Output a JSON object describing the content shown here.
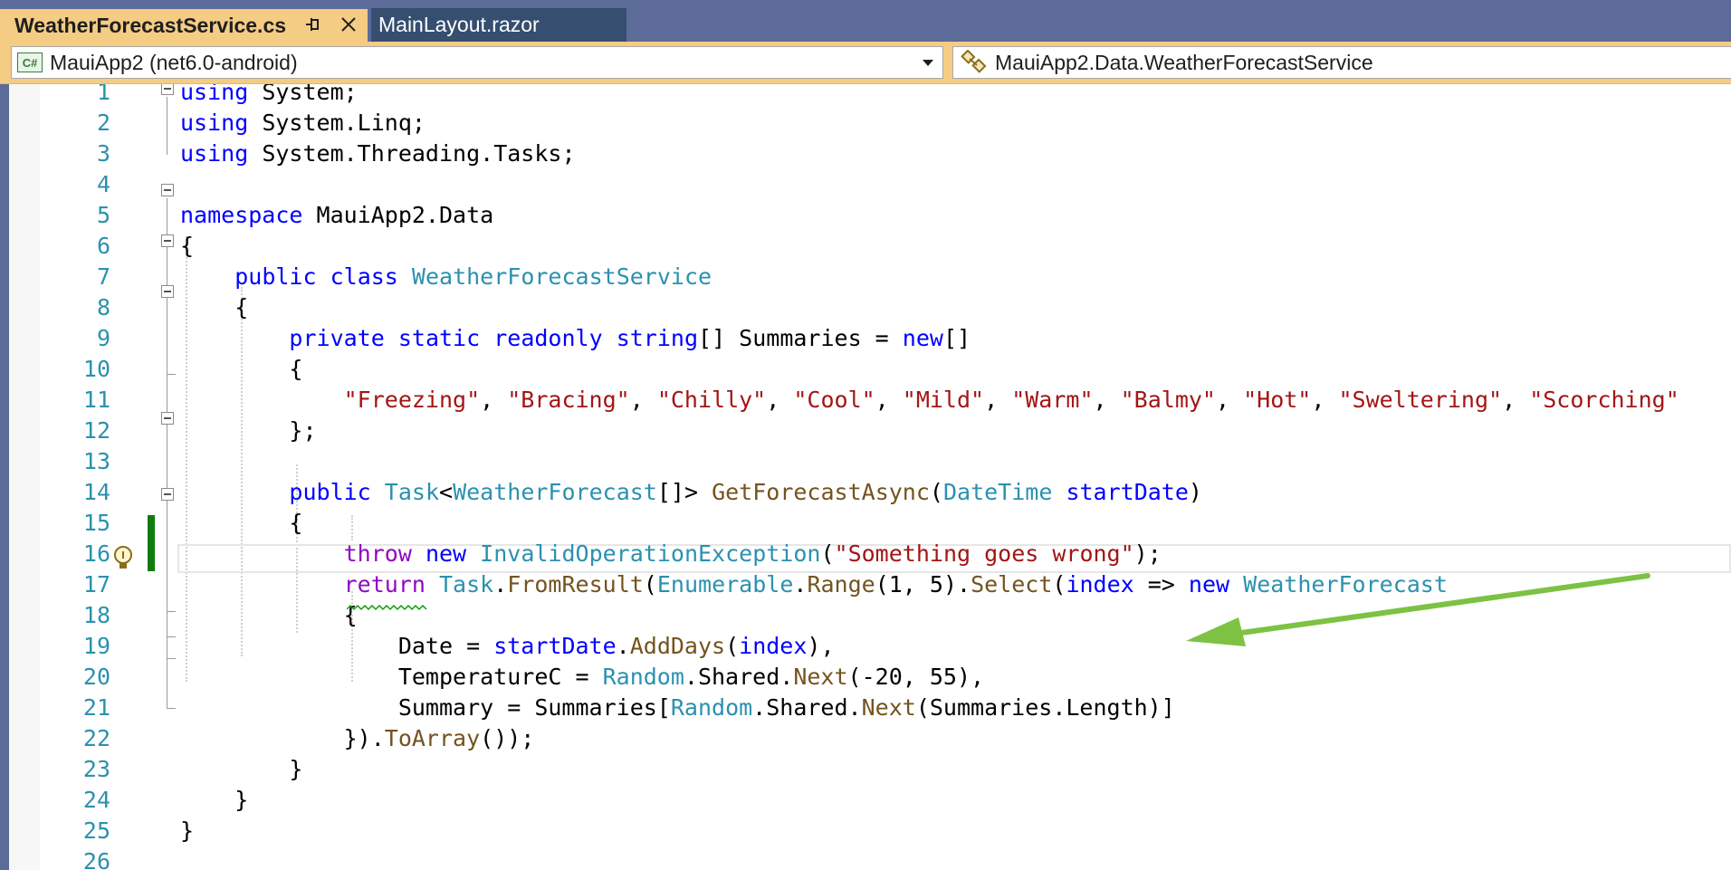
{
  "tabs": [
    {
      "label": "WeatherForecastService.cs",
      "active": true
    },
    {
      "label": "MainLayout.razor",
      "active": false
    }
  ],
  "navbar": {
    "project_icon": "C#",
    "project": "MauiApp2 (net6.0-android)",
    "type": "MauiApp2.Data.WeatherForecastService"
  },
  "colors": {
    "keyword": "#0000ff",
    "control_keyword": "#8f08c4",
    "type": "#2b91af",
    "string": "#a31515",
    "method": "#74531f",
    "line_number": "#2b91af",
    "active_tab": "#f5cc84",
    "change_bar": "#107c10",
    "annotation_arrow": "#7dc243"
  },
  "editor": {
    "highlighted_line": 16,
    "lines": [
      {
        "n": "1",
        "tokens": [
          {
            "t": "using",
            "c": "kw"
          },
          {
            "t": " System;"
          }
        ]
      },
      {
        "n": "2",
        "tokens": [
          {
            "t": "using",
            "c": "kw"
          },
          {
            "t": " System.Linq;"
          }
        ]
      },
      {
        "n": "3",
        "tokens": [
          {
            "t": "using",
            "c": "kw"
          },
          {
            "t": " System.Threading.Tasks;"
          }
        ]
      },
      {
        "n": "4",
        "tokens": []
      },
      {
        "n": "5",
        "tokens": [
          {
            "t": "namespace",
            "c": "kw"
          },
          {
            "t": " MauiApp2.Data"
          }
        ]
      },
      {
        "n": "6",
        "tokens": [
          {
            "t": "{"
          }
        ]
      },
      {
        "n": "7",
        "tokens": [
          {
            "t": "    "
          },
          {
            "t": "public",
            "c": "kw"
          },
          {
            "t": " "
          },
          {
            "t": "class",
            "c": "kw"
          },
          {
            "t": " "
          },
          {
            "t": "WeatherForecastService",
            "c": "ty"
          }
        ]
      },
      {
        "n": "8",
        "tokens": [
          {
            "t": "    {"
          }
        ]
      },
      {
        "n": "9",
        "tokens": [
          {
            "t": "        "
          },
          {
            "t": "private",
            "c": "kw"
          },
          {
            "t": " "
          },
          {
            "t": "static",
            "c": "kw"
          },
          {
            "t": " "
          },
          {
            "t": "readonly",
            "c": "kw"
          },
          {
            "t": " "
          },
          {
            "t": "string",
            "c": "kw"
          },
          {
            "t": "[] Summaries = "
          },
          {
            "t": "new",
            "c": "kw"
          },
          {
            "t": "[]"
          }
        ]
      },
      {
        "n": "10",
        "tokens": [
          {
            "t": "        {"
          }
        ]
      },
      {
        "n": "11",
        "tokens": [
          {
            "t": "            "
          },
          {
            "t": "\"Freezing\"",
            "c": "str"
          },
          {
            "t": ", "
          },
          {
            "t": "\"Bracing\"",
            "c": "str"
          },
          {
            "t": ", "
          },
          {
            "t": "\"Chilly\"",
            "c": "str"
          },
          {
            "t": ", "
          },
          {
            "t": "\"Cool\"",
            "c": "str"
          },
          {
            "t": ", "
          },
          {
            "t": "\"Mild\"",
            "c": "str"
          },
          {
            "t": ", "
          },
          {
            "t": "\"Warm\"",
            "c": "str"
          },
          {
            "t": ", "
          },
          {
            "t": "\"Balmy\"",
            "c": "str"
          },
          {
            "t": ", "
          },
          {
            "t": "\"Hot\"",
            "c": "str"
          },
          {
            "t": ", "
          },
          {
            "t": "\"Sweltering\"",
            "c": "str"
          },
          {
            "t": ", "
          },
          {
            "t": "\"Scorching\"",
            "c": "str"
          }
        ]
      },
      {
        "n": "12",
        "tokens": [
          {
            "t": "        };"
          }
        ]
      },
      {
        "n": "13",
        "tokens": []
      },
      {
        "n": "14",
        "tokens": [
          {
            "t": "        "
          },
          {
            "t": "public",
            "c": "kw"
          },
          {
            "t": " "
          },
          {
            "t": "Task",
            "c": "ty"
          },
          {
            "t": "<"
          },
          {
            "t": "WeatherForecast",
            "c": "ty"
          },
          {
            "t": "[]> "
          },
          {
            "t": "GetForecastAsync",
            "c": "fn"
          },
          {
            "t": "("
          },
          {
            "t": "DateTime",
            "c": "ty"
          },
          {
            "t": " "
          },
          {
            "t": "startDate",
            "c": "kw"
          },
          {
            "t": ")"
          }
        ]
      },
      {
        "n": "15",
        "tokens": [
          {
            "t": "        {"
          }
        ]
      },
      {
        "n": "16",
        "tokens": [
          {
            "t": "            "
          },
          {
            "t": "throw",
            "c": "kw2"
          },
          {
            "t": " "
          },
          {
            "t": "new",
            "c": "kw"
          },
          {
            "t": " "
          },
          {
            "t": "InvalidOperationException",
            "c": "ty"
          },
          {
            "t": "("
          },
          {
            "t": "\"Something goes wrong\"",
            "c": "str"
          },
          {
            "t": ");"
          }
        ]
      },
      {
        "n": "17",
        "tokens": [
          {
            "t": "            "
          },
          {
            "t": "return",
            "c": "kw2"
          },
          {
            "t": " "
          },
          {
            "t": "Task",
            "c": "ty"
          },
          {
            "t": "."
          },
          {
            "t": "FromResult",
            "c": "fn"
          },
          {
            "t": "("
          },
          {
            "t": "Enumerable",
            "c": "ty"
          },
          {
            "t": "."
          },
          {
            "t": "Range",
            "c": "fn"
          },
          {
            "t": "(1, 5)."
          },
          {
            "t": "Select",
            "c": "fn"
          },
          {
            "t": "("
          },
          {
            "t": "index",
            "c": "kw"
          },
          {
            "t": " => "
          },
          {
            "t": "new",
            "c": "kw"
          },
          {
            "t": " "
          },
          {
            "t": "WeatherForecast",
            "c": "ty"
          }
        ]
      },
      {
        "n": "18",
        "tokens": [
          {
            "t": "            {"
          }
        ]
      },
      {
        "n": "19",
        "tokens": [
          {
            "t": "                Date = "
          },
          {
            "t": "startDate",
            "c": "kw"
          },
          {
            "t": "."
          },
          {
            "t": "AddDays",
            "c": "fn"
          },
          {
            "t": "("
          },
          {
            "t": "index",
            "c": "kw"
          },
          {
            "t": "),"
          }
        ]
      },
      {
        "n": "20",
        "tokens": [
          {
            "t": "                TemperatureC = "
          },
          {
            "t": "Random",
            "c": "ty"
          },
          {
            "t": ".Shared."
          },
          {
            "t": "Next",
            "c": "fn"
          },
          {
            "t": "(-20, 55),"
          }
        ]
      },
      {
        "n": "21",
        "tokens": [
          {
            "t": "                Summary = Summaries["
          },
          {
            "t": "Random",
            "c": "ty"
          },
          {
            "t": ".Shared."
          },
          {
            "t": "Next",
            "c": "fn"
          },
          {
            "t": "(Summaries.Length)]"
          }
        ]
      },
      {
        "n": "22",
        "tokens": [
          {
            "t": "            })."
          },
          {
            "t": "ToArray",
            "c": "fn"
          },
          {
            "t": "());"
          }
        ]
      },
      {
        "n": "23",
        "tokens": [
          {
            "t": "        }"
          }
        ]
      },
      {
        "n": "24",
        "tokens": [
          {
            "t": "    }"
          }
        ]
      },
      {
        "n": "25",
        "tokens": [
          {
            "t": "}"
          }
        ]
      },
      {
        "n": "26",
        "tokens": []
      }
    ]
  }
}
